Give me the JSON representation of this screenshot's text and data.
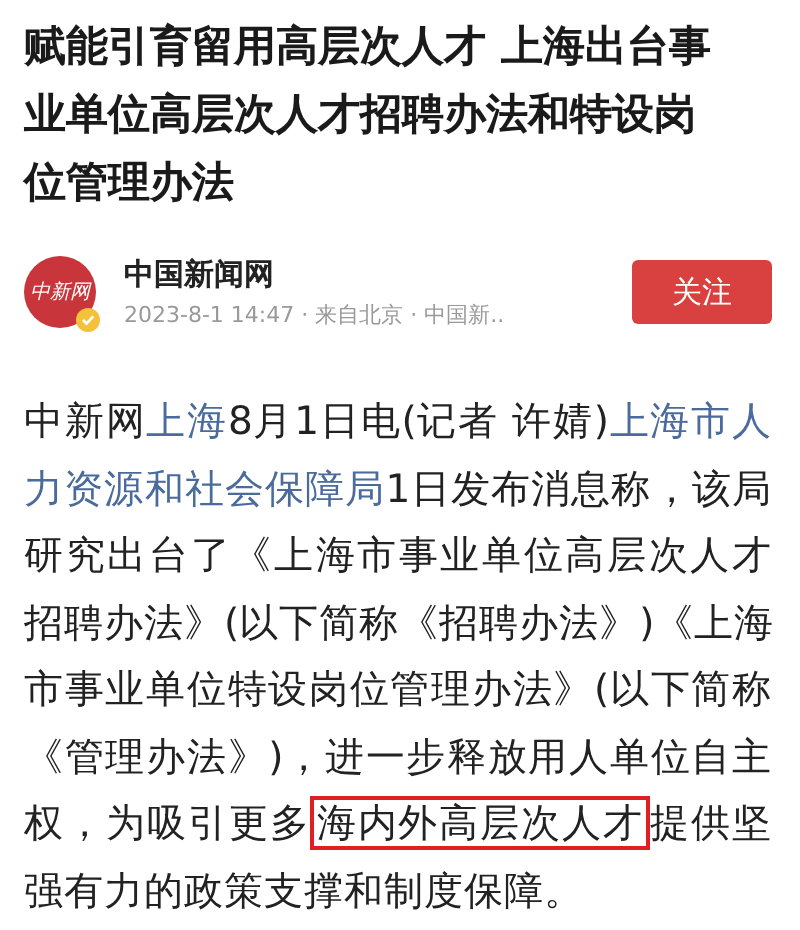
{
  "article": {
    "title_lines": [
      "赋能引育留用高层次人才 上海出台事",
      "业单位高层次人才招聘办法和特设岗",
      "位管理办法"
    ],
    "source": {
      "logo_text": "中新网",
      "name": "中国新闻网",
      "meta": "2023-8-1 14:47 · 来自北京 · 中国新..",
      "verified": true
    },
    "follow_button": {
      "label": "关注",
      "followed": false
    },
    "body_lines": [
      [
        {
          "kind": "text",
          "text": "中新网"
        },
        {
          "kind": "link",
          "text": "上海"
        },
        {
          "kind": "text",
          "text": "8月1日电(记者 许婧)"
        },
        {
          "kind": "link",
          "text": "上海市人"
        }
      ],
      [
        {
          "kind": "link",
          "text": "力资源和社会保障局"
        },
        {
          "kind": "text",
          "text": "1日发布消息称，该局"
        }
      ],
      [
        {
          "kind": "text",
          "text": "研究出台了《上海市事业单位高层次人才"
        }
      ],
      [
        {
          "kind": "text",
          "text": "招聘办法》(以下简称《招聘办法》)《上海"
        }
      ],
      [
        {
          "kind": "text",
          "text": "市事业单位特设岗位管理办法》(以下简称"
        }
      ],
      [
        {
          "kind": "text",
          "text": "《管理办法》)，进一步释放用人单位自主"
        }
      ],
      [
        {
          "kind": "text",
          "text": "权，为吸引更多"
        },
        {
          "kind": "boxed",
          "text": "海内外高层次人才"
        },
        {
          "kind": "text",
          "text": "提供坚"
        }
      ],
      [
        {
          "kind": "text",
          "text": "强有力的政策支撑和制度保障。"
        }
      ]
    ]
  }
}
